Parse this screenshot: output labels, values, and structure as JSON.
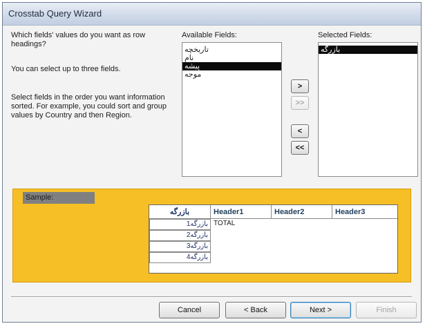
{
  "window": {
    "title": "Crosstab Query Wizard"
  },
  "instructions": {
    "question": "Which fields' values do you want as row headings?",
    "limit": "You can select up to three fields.",
    "order": "Select fields in the order you want information sorted.  For example, you could sort and group values by Country and then Region."
  },
  "available": {
    "label": "Available Fields:",
    "items": [
      {
        "label": "تاریخچه",
        "selected": false
      },
      {
        "label": "نام",
        "selected": false
      },
      {
        "label": "پیشه",
        "selected": true
      },
      {
        "label": "موجه",
        "selected": false
      }
    ]
  },
  "selected_fields": {
    "label": "Selected Fields:",
    "items": [
      {
        "label": "بازرگه",
        "selected": true
      }
    ]
  },
  "move_buttons": {
    "add_one": ">",
    "add_all": ">>",
    "remove_one": "<",
    "remove_all": "<<"
  },
  "sample": {
    "label": "Sample:",
    "row_heading": "بازرگه",
    "column_headers": [
      "Header1",
      "Header2",
      "Header3"
    ],
    "total_label": "TOTAL",
    "rows": [
      "بازرگه1",
      "بازرگه2",
      "بازرگه3",
      "بازرگه4"
    ]
  },
  "buttons": {
    "cancel": "Cancel",
    "back": "< Back",
    "next": "Next >",
    "finish": "Finish"
  },
  "colors": {
    "sample_background": "#f6bf25",
    "selection": "#0a0a0a"
  }
}
